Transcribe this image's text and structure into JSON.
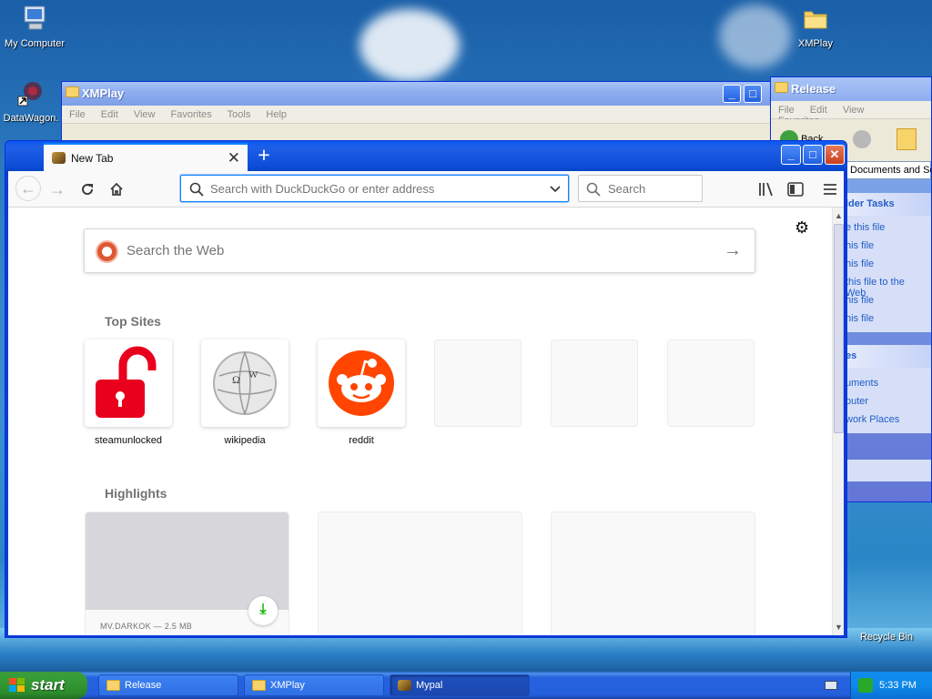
{
  "desktop": {
    "icons": [
      {
        "label": "My Computer"
      },
      {
        "label": "DataWagon."
      },
      {
        "label": "XMPlay"
      },
      {
        "label": "Recycle Bin"
      }
    ]
  },
  "xmplay_window": {
    "title": "XMPlay",
    "menu": [
      "File",
      "Edit",
      "View",
      "Favorites",
      "Tools",
      "Help"
    ]
  },
  "release_window": {
    "title": "Release",
    "menu": [
      "File",
      "Edit",
      "View",
      "Favorites"
    ],
    "back_label": "Back",
    "address_fragment": "Documents and Se",
    "file_tasks_head": "lder Tasks",
    "file_tasks": [
      "e this file",
      "his file",
      "his file",
      "this file to the Web",
      "his file",
      "his file"
    ],
    "other_head": "es",
    "other_links": [
      "uments",
      "puter",
      "work Places"
    ]
  },
  "browser": {
    "tab_title": "New Tab",
    "url_placeholder": "Search with DuckDuckGo or enter address",
    "search_placeholder": "Search",
    "web_search_placeholder": "Search the Web",
    "top_sites_title": "Top Sites",
    "top_sites": [
      {
        "label": "steamunlocked",
        "icon": "red-open-padlock-icon"
      },
      {
        "label": "wikipedia",
        "icon": "wikipedia-globe-icon"
      },
      {
        "label": "reddit",
        "icon": "reddit-alien-icon"
      }
    ],
    "highlights_title": "Highlights",
    "highlight_card": {
      "meta": "MV.DARKOK — 2.5 MB"
    }
  },
  "taskbar": {
    "start_label": "start",
    "tasks": [
      {
        "label": "Release"
      },
      {
        "label": "XMPlay"
      },
      {
        "label": "Mypal"
      }
    ],
    "clock": "5:33 PM"
  },
  "colors": {
    "accent": "#0a84ff",
    "xp_blue": "#0831d9",
    "start_green": "#379e37",
    "reddit_orange": "#ff4500",
    "steam_red": "#e8001c"
  }
}
